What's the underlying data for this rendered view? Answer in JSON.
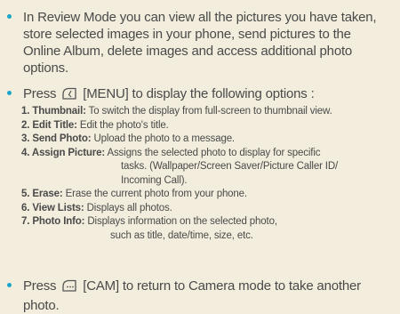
{
  "bullets": {
    "review": "In Review Mode you can view all the pictures you have taken, store selected images in your phone, send pictures to the Online Album, delete images and access additional photo options.",
    "menu_pre": "Press",
    "menu_post": "[MENU] to display the following options :",
    "cam_pre": "Press",
    "cam_post": "[CAM] to return to Camera mode to take another photo."
  },
  "icons": {
    "menu": "menu-key-icon",
    "cam": "cam-key-icon",
    "accent": "#1aa6c9"
  },
  "options": [
    {
      "key": "1. Thumbnail:",
      "desc": "To switch the display from full-screen to thumbnail view."
    },
    {
      "key": "2. Edit Title:",
      "desc": "Edit the photo's title."
    },
    {
      "key": "3. Send Photo:",
      "desc": "Upload the photo to a message."
    },
    {
      "key": "4. Assign Picture:",
      "desc": "Assigns the selected photo to display for specific",
      "cont1": "tasks. (Wallpaper/Screen Saver/Picture Caller ID/",
      "cont2": "Incoming Call)."
    },
    {
      "key": "5. Erase:",
      "desc": "Erase the current photo from your phone."
    },
    {
      "key": "6. View Lists:",
      "desc": "Displays all photos."
    },
    {
      "key": "7. Photo Info:",
      "desc": "Displays information on the selected photo,",
      "cont1": "such as title, date/time, size, etc."
    }
  ]
}
